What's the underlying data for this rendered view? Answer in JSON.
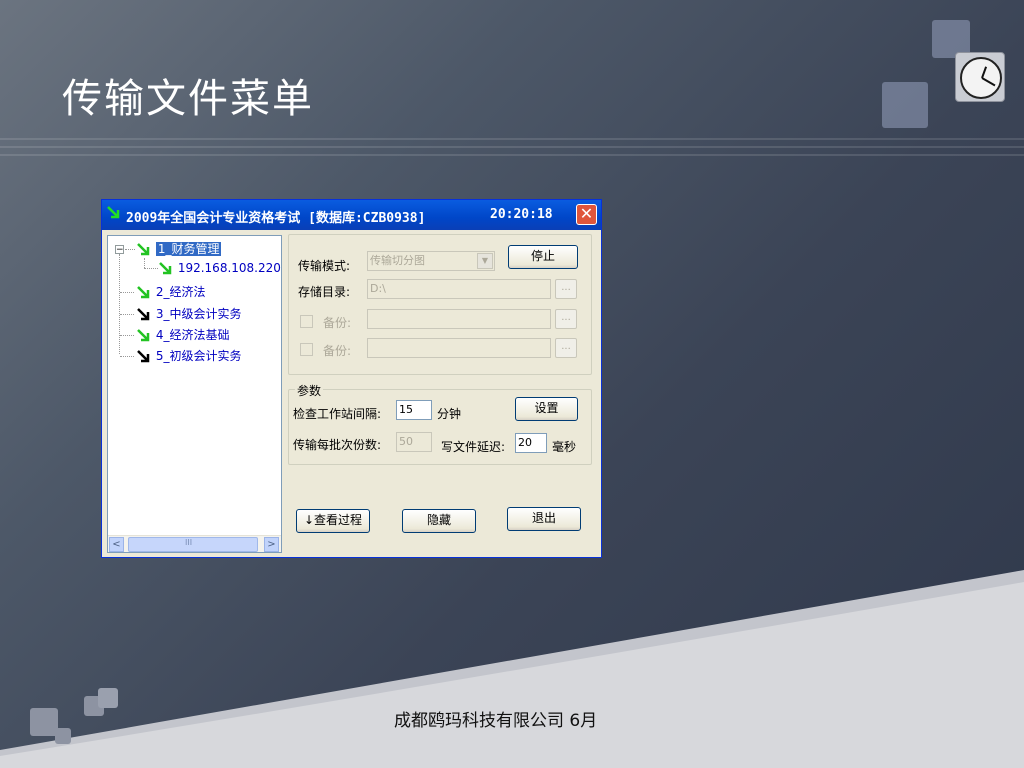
{
  "slide": {
    "title": "传输文件菜单",
    "footer": "成都鸥玛科技有限公司 6月"
  },
  "window": {
    "title": "2009年全国会计专业资格考试 [数据库:CZB0938]",
    "time": "20:20:18",
    "close_label": "✕"
  },
  "tree": {
    "items": [
      {
        "label": "1_财务管理",
        "selected": true
      },
      {
        "label": "192.168.108.220"
      },
      {
        "label": "2_经济法"
      },
      {
        "label": "3_中级会计实务"
      },
      {
        "label": "4_经济法基础"
      },
      {
        "label": "5_初级会计实务"
      }
    ],
    "expander": "−",
    "scroll_left": "<",
    "scroll_right": ">",
    "scroll_grip": "III"
  },
  "transfer": {
    "mode_label": "传输模式:",
    "mode_value": "传输切分图",
    "stop_label": "停止",
    "dir_label": "存储目录:",
    "dir_value": "D:\\",
    "browse_label": "...",
    "backup_label": "备份:"
  },
  "params": {
    "legend": "参数",
    "interval_label": "检查工作站间隔:",
    "interval_value": "15",
    "interval_unit": "分钟",
    "settings_label": "设置",
    "batch_label": "传输每批次份数:",
    "batch_value": "50",
    "delay_label": "写文件延迟:",
    "delay_value": "20",
    "delay_unit": "毫秒"
  },
  "buttons": {
    "view_process": "↓查看过程",
    "hide": "隐藏",
    "exit": "退出"
  },
  "colors": {
    "arrow_green": "#22c322",
    "arrow_black": "#000000",
    "titlebar": "#0046c8",
    "window_bg": "#ece9d8"
  }
}
